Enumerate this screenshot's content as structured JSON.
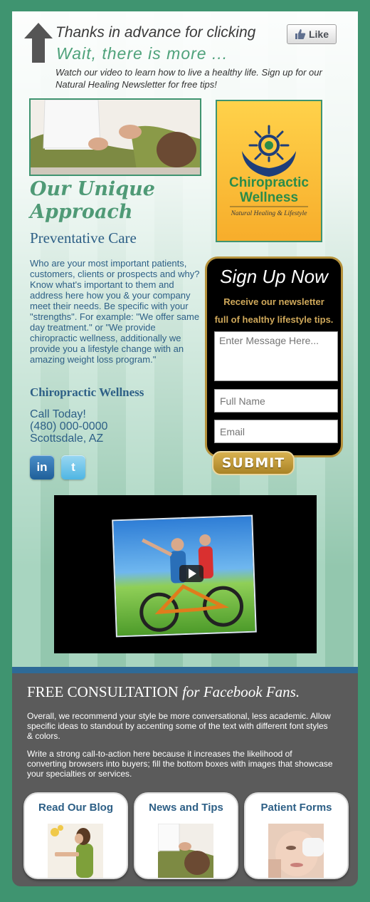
{
  "header": {
    "thanks": "Thanks in advance for clicking",
    "like_label": "Like",
    "wait": "Wait, there is more ...",
    "intro": "Watch our video to learn how to live a healthy life. Sign up for our Natural Healing Newsletter for free tips!"
  },
  "logo": {
    "line1": "Chiropractic",
    "line2": "Wellness",
    "tagline": "Natural Healing & Lifestyle"
  },
  "main": {
    "approach_title": "Our Unique Approach",
    "subtitle": "Preventative Care",
    "body": "Who are your most important patients, customers, clients or prospects and why? Know what's important to them and address here how you & your company meet their needs. Be specific with your \"strengths\". For example: \"We offer same day treatment.\" or \"We provide chiropractic wellness, additionally we provide you a lifestyle change with an amazing weight loss program.\"",
    "company": "Chiropractic Wellness",
    "call": "Call Today!",
    "phone": "(480) 000-0000",
    "city": "Scottsdale, AZ"
  },
  "social": {
    "linkedin": "in",
    "twitter": "t"
  },
  "signup": {
    "title": "Sign Up Now",
    "sub1": "Receive our newsletter",
    "sub2": "full of healthy lifestyle tips.",
    "message_placeholder": "Enter Message Here...",
    "name_placeholder": "Full Name",
    "email_placeholder": "Email",
    "submit": "SUBMIT"
  },
  "footer": {
    "free": "FREE CONSULTATION",
    "free_em": "for Facebook Fans.",
    "p1": "Overall, we recommend your style be more conversational, less academic. Allow specific ideas to standout by accenting some of the text with different font styles & colors.",
    "p2": "Write a strong call-to-action here because it increases the likelihood of converting browsers into buyers; fill the bottom boxes with images that showcase your specialties or services.",
    "cards": [
      {
        "label": "Read Our Blog"
      },
      {
        "label": "News and Tips"
      },
      {
        "label": "Patient Forms"
      }
    ]
  },
  "colors": {
    "background": "#3f9470",
    "heading_green": "#4f9a76",
    "text_blue": "#2d5f86",
    "gold": "#b5923c",
    "footer_gray": "#5b5b5b"
  }
}
